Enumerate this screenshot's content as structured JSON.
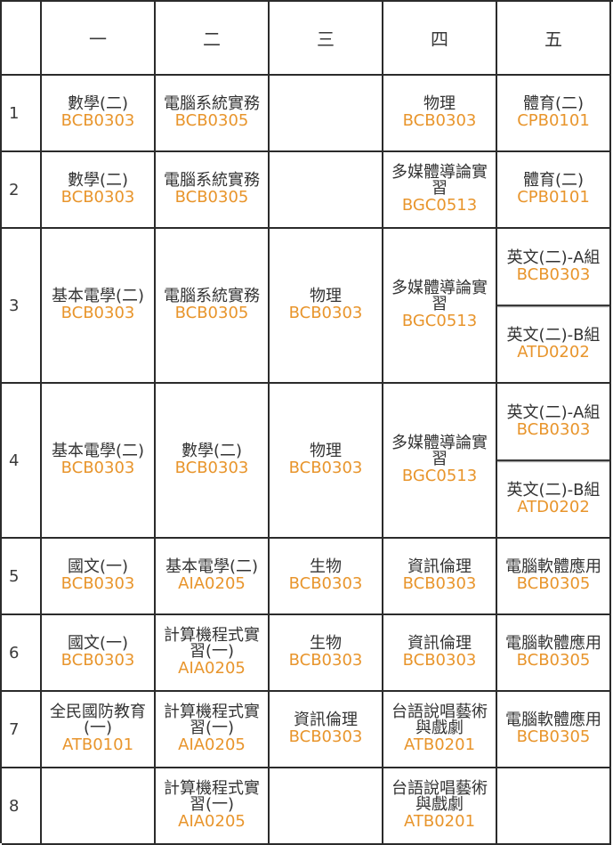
{
  "headers": [
    "",
    "一",
    "二",
    "三",
    "四",
    "五"
  ],
  "rows": [
    {
      "num": "1",
      "cells": [
        [
          {
            "name": "數學(二)",
            "code": "BCB0303"
          }
        ],
        [
          {
            "name": "電腦系統實務",
            "code": "BCB0305"
          }
        ],
        [],
        [
          {
            "name": "物理",
            "code": "BCB0303"
          }
        ],
        [
          {
            "name": "體育(二)",
            "code": "CPB0101"
          }
        ]
      ]
    },
    {
      "num": "2",
      "cells": [
        [
          {
            "name": "數學(二)",
            "code": "BCB0303"
          }
        ],
        [
          {
            "name": "電腦系統實務",
            "code": "BCB0305"
          }
        ],
        [],
        [
          {
            "name": "多媒體導論實習",
            "code": "BGC0513"
          }
        ],
        [
          {
            "name": "體育(二)",
            "code": "CPB0101"
          }
        ]
      ]
    },
    {
      "num": "3",
      "cells": [
        [
          {
            "name": "基本電學(二)",
            "code": "BCB0303"
          }
        ],
        [
          {
            "name": "電腦系統實務",
            "code": "BCB0305"
          }
        ],
        [
          {
            "name": "物理",
            "code": "BCB0303"
          }
        ],
        [
          {
            "name": "多媒體導論實習",
            "code": "BGC0513"
          }
        ],
        [
          {
            "name": "英文(二)-A組",
            "code": "BCB0303"
          },
          {
            "name": "英文(二)-B組",
            "code": "ATD0202"
          }
        ]
      ]
    },
    {
      "num": "4",
      "cells": [
        [
          {
            "name": "基本電學(二)",
            "code": "BCB0303"
          }
        ],
        [
          {
            "name": "數學(二)",
            "code": "BCB0303"
          }
        ],
        [
          {
            "name": "物理",
            "code": "BCB0303"
          }
        ],
        [
          {
            "name": "多媒體導論實習",
            "code": "BGC0513"
          }
        ],
        [
          {
            "name": "英文(二)-A組",
            "code": "BCB0303"
          },
          {
            "name": "英文(二)-B組",
            "code": "ATD0202"
          }
        ]
      ]
    },
    {
      "num": "5",
      "cells": [
        [
          {
            "name": "國文(一)",
            "code": "BCB0303"
          }
        ],
        [
          {
            "name": "基本電學(二)",
            "code": "AIA0205"
          }
        ],
        [
          {
            "name": "生物",
            "code": "BCB0303"
          }
        ],
        [
          {
            "name": "資訊倫理",
            "code": "BCB0303"
          }
        ],
        [
          {
            "name": "電腦軟體應用",
            "code": "BCB0305"
          }
        ]
      ]
    },
    {
      "num": "6",
      "cells": [
        [
          {
            "name": "國文(一)",
            "code": "BCB0303"
          }
        ],
        [
          {
            "name": "計算機程式實習(一)",
            "code": "AIA0205"
          }
        ],
        [
          {
            "name": "生物",
            "code": "BCB0303"
          }
        ],
        [
          {
            "name": "資訊倫理",
            "code": "BCB0303"
          }
        ],
        [
          {
            "name": "電腦軟體應用",
            "code": "BCB0305"
          }
        ]
      ]
    },
    {
      "num": "7",
      "cells": [
        [
          {
            "name": "全民國防教育(一)",
            "code": "ATB0101"
          }
        ],
        [
          {
            "name": "計算機程式實習(一)",
            "code": "AIA0205"
          }
        ],
        [
          {
            "name": "資訊倫理",
            "code": "BCB0303"
          }
        ],
        [
          {
            "name": "台語說唱藝術與戲劇",
            "code": "ATB0201"
          }
        ],
        [
          {
            "name": "電腦軟體應用",
            "code": "BCB0305"
          }
        ]
      ]
    },
    {
      "num": "8",
      "cells": [
        [],
        [
          {
            "name": "計算機程式實習(一)",
            "code": "AIA0205"
          }
        ],
        [],
        [
          {
            "name": "台語說唱藝術與戲劇",
            "code": "ATB0201"
          }
        ],
        []
      ]
    }
  ]
}
